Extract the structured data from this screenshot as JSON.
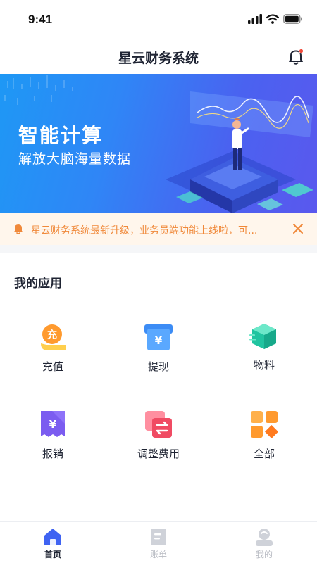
{
  "status_bar": {
    "time": "9:41"
  },
  "header": {
    "title": "星云财务系统"
  },
  "banner": {
    "title": "智能计算",
    "subtitle": "解放大脑海量数据"
  },
  "notice": {
    "text": "星云财务系统最新升级，业务员端功能上线啦，可..."
  },
  "apps": {
    "section_title": "我的应用",
    "items": [
      {
        "label": "充值",
        "icon": "recharge-icon",
        "badge": "充"
      },
      {
        "label": "提现",
        "icon": "withdraw-icon",
        "badge": "¥"
      },
      {
        "label": "物料",
        "icon": "materials-icon"
      },
      {
        "label": "报销",
        "icon": "reimburse-icon",
        "badge": "¥"
      },
      {
        "label": "调整费用",
        "icon": "adjust-fee-icon"
      },
      {
        "label": "全部",
        "icon": "all-apps-icon"
      }
    ]
  },
  "tabbar": {
    "items": [
      {
        "label": "首页",
        "icon": "home-icon",
        "active": true
      },
      {
        "label": "账单",
        "icon": "bill-icon",
        "active": false
      },
      {
        "label": "我的",
        "icon": "profile-icon",
        "active": false
      }
    ]
  },
  "colors": {
    "primary": "#3f63f2",
    "notice": "#f0893a",
    "text": "#1f2433"
  }
}
